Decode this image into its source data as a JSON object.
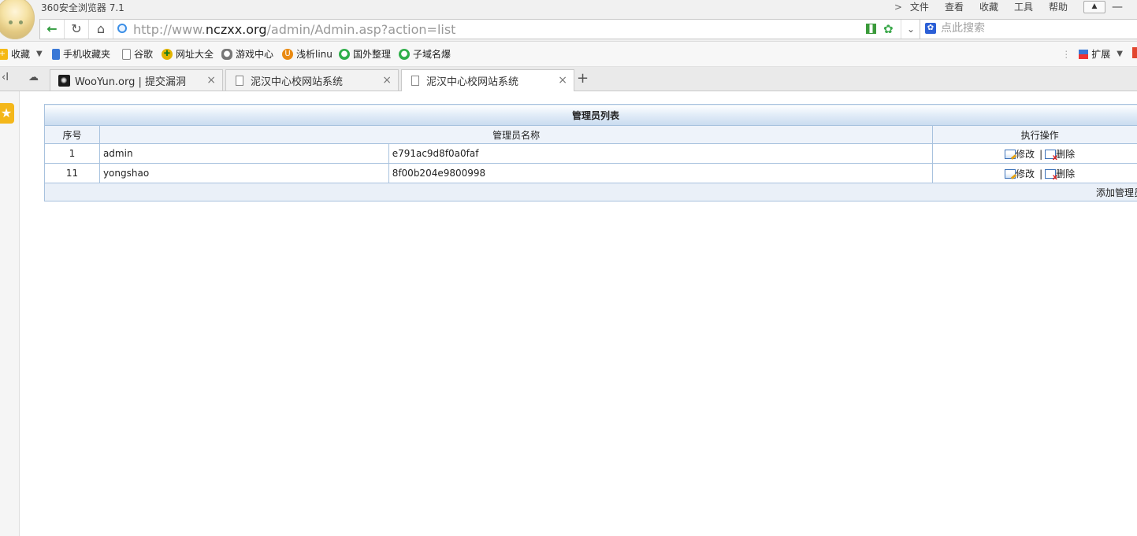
{
  "browser": {
    "app_title": "360安全浏览器 7.1",
    "menu": [
      "文件",
      "查看",
      "收藏",
      "工具",
      "帮助"
    ]
  },
  "address": {
    "url_prefix": "http://www.",
    "url_host": "nczxx.org",
    "url_path": "/admin/Admin.asp?action=list",
    "search_placeholder": "点此搜索"
  },
  "bookmarks": {
    "items": [
      {
        "label": "收藏",
        "icon": "star-icon"
      },
      {
        "label": "手机收藏夹",
        "icon": "phone-icon"
      },
      {
        "label": "谷歌",
        "icon": "page-icon"
      },
      {
        "label": "网址大全",
        "icon": "nav-icon"
      },
      {
        "label": "游戏中心",
        "icon": "gamepad-icon"
      },
      {
        "label": "浅析linu",
        "icon": "u-icon"
      },
      {
        "label": "国外整理",
        "icon": "globe-icon"
      },
      {
        "label": "子域名爆",
        "icon": "globe-icon"
      }
    ],
    "extensions_label": "扩展"
  },
  "tabs": [
    {
      "title": "WooYun.org | 提交漏洞",
      "active": false
    },
    {
      "title": "泥汉中心校网站系统",
      "active": false
    },
    {
      "title": "泥汉中心校网站系统",
      "active": true
    }
  ],
  "admin_table": {
    "caption": "管理员列表",
    "headers": {
      "index": "序号",
      "name": "管理员名称",
      "ops": "执行操作"
    },
    "rows": [
      {
        "index": "1",
        "name": "admin",
        "hash": "e791ac9d8f0a0faf"
      },
      {
        "index": "11",
        "name": "yongshao",
        "hash": "8f00b204e9800998"
      }
    ],
    "edit_label": "修改",
    "separator": "|",
    "delete_label": "删除",
    "add_label": "添加管理员"
  }
}
